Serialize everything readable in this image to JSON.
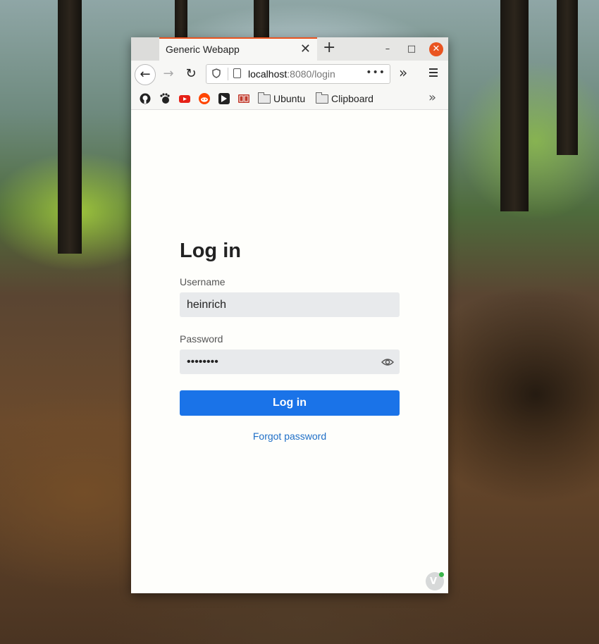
{
  "browser": {
    "tab_title": "Generic Webapp",
    "close_tab_glyph": "✕",
    "new_tab_glyph": "+",
    "window_minimize_glyph": "–",
    "window_maximize_glyph": "□",
    "window_close_glyph": "✕",
    "url_host": "localhost",
    "url_rest": ":8080/login",
    "url_more_glyph": "•••",
    "overflow_glyph": "»"
  },
  "bookmarks": {
    "icons": [
      "github-icon",
      "gnome-icon",
      "youtube-icon",
      "reddit-icon",
      "terminal-icon",
      "db-icon"
    ],
    "folders": [
      {
        "label": "Ubuntu"
      },
      {
        "label": "Clipboard"
      }
    ],
    "more_glyph": "»"
  },
  "login": {
    "title": "Log in",
    "username_label": "Username",
    "username_value": "heinrich",
    "password_label": "Password",
    "password_value": "••••••••",
    "submit_label": "Log in",
    "forgot_label": "Forgot password"
  },
  "colors": {
    "accent": "#1a73e8",
    "tab_accent": "#e95420",
    "link": "#1f6fc7"
  }
}
